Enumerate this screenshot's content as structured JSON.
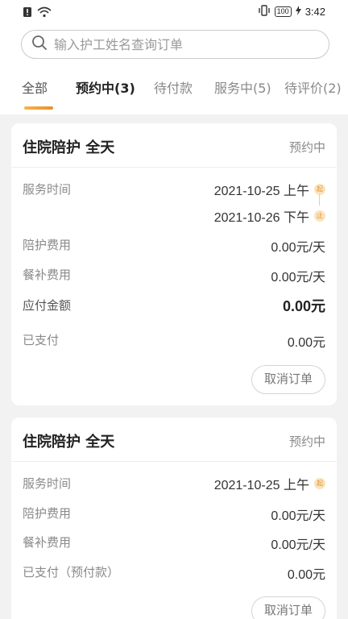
{
  "status_bar": {
    "time": "3:42",
    "battery": "100"
  },
  "search": {
    "placeholder": "输入护工姓名查询订单",
    "value": ""
  },
  "tabs": [
    {
      "label": "全部"
    },
    {
      "label": "预约中(3)"
    },
    {
      "label": "待付款"
    },
    {
      "label": "服务中(5)"
    },
    {
      "label": "待评价(2)"
    }
  ],
  "orders": [
    {
      "title": "住院陪护 全天",
      "status": "预约中",
      "service_time_label": "服务时间",
      "start_time": "2021-10-25  上午",
      "start_badge": "起",
      "end_time": "2021-10-26  下午",
      "end_badge": "止",
      "care_fee_label": "陪护费用",
      "care_fee": "0.00元/天",
      "meal_fee_label": "餐补费用",
      "meal_fee": "0.00元/天",
      "payable_label": "应付金额",
      "payable": "0.00元",
      "paid_label": "已支付",
      "paid": "0.00元",
      "cancel_label": "取消订单"
    },
    {
      "title": "住院陪护 全天",
      "status": "预约中",
      "service_time_label": "服务时间",
      "start_time": "2021-10-25  上午",
      "start_badge": "起",
      "care_fee_label": "陪护费用",
      "care_fee": "0.00元/天",
      "meal_fee_label": "餐补费用",
      "meal_fee": "0.00元/天",
      "paid_label": "已支付（预付款）",
      "paid": "0.00元",
      "cancel_label": "取消订单"
    }
  ]
}
